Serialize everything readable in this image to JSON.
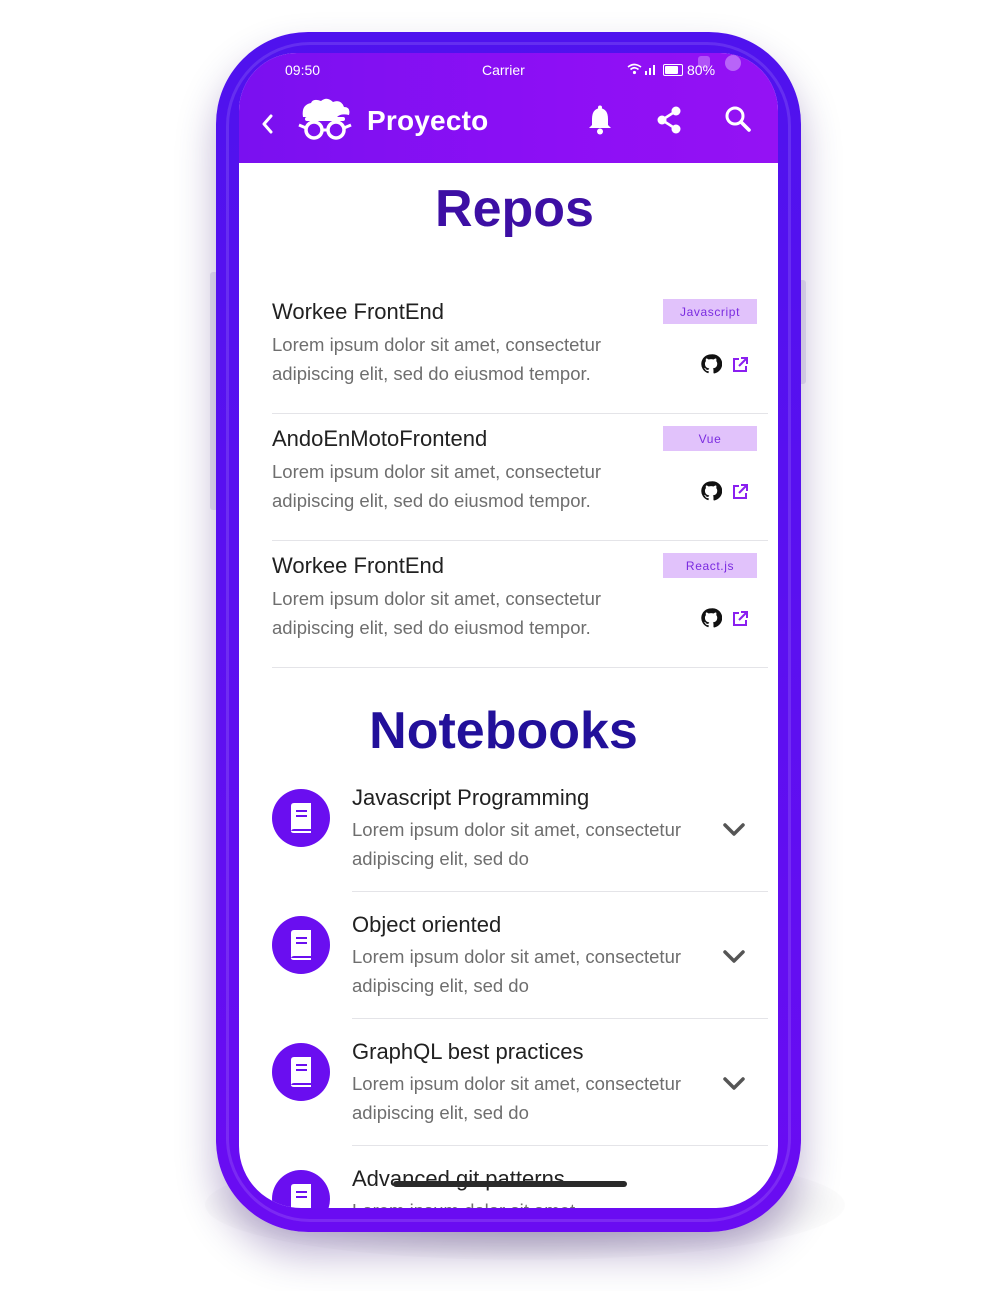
{
  "status_bar": {
    "time": "09:50",
    "carrier": "Carrier",
    "battery": "80%"
  },
  "app_bar": {
    "title": "Proyecto"
  },
  "repos": {
    "title": "Repos",
    "items": [
      {
        "name": "Workee FrontEnd",
        "description": "Lorem ipsum dolor sit amet, consectetur adipiscing elit, sed do eiusmod tempor.",
        "tag": "Javascript"
      },
      {
        "name": "AndoEnMotoFrontend",
        "description": "Lorem ipsum dolor sit amet, consectetur adipiscing elit, sed do eiusmod tempor.",
        "tag": "Vue"
      },
      {
        "name": "Workee FrontEnd",
        "description": "Lorem ipsum dolor sit amet, consectetur adipiscing elit, sed do eiusmod tempor.",
        "tag": "React.js"
      }
    ]
  },
  "notebooks": {
    "title": "Notebooks",
    "items": [
      {
        "title": "Javascript Programming",
        "description": "Lorem ipsum dolor sit amet, consectetur adipiscing elit, sed do"
      },
      {
        "title": "Object oriented",
        "description": "Lorem ipsum dolor sit amet, consectetur adipiscing elit, sed do"
      },
      {
        "title": "GraphQL best practices",
        "description": "Lorem ipsum dolor sit amet, consectetur adipiscing elit, sed do"
      },
      {
        "title": "Advanced git patterns",
        "description": "Lorem ipsum dolor sit amet,"
      }
    ]
  },
  "colors": {
    "primary": "#7a10f0",
    "heading": "#3d0fa4",
    "tag_bg": "#e1c2fb",
    "tag_text": "#7a2be0",
    "frame": "#5a10f0"
  },
  "icons": [
    "back-arrow-icon",
    "logo-icon",
    "bell-icon",
    "share-icon",
    "search-icon",
    "github-icon",
    "external-link-icon",
    "book-icon",
    "chevron-down-icon"
  ]
}
